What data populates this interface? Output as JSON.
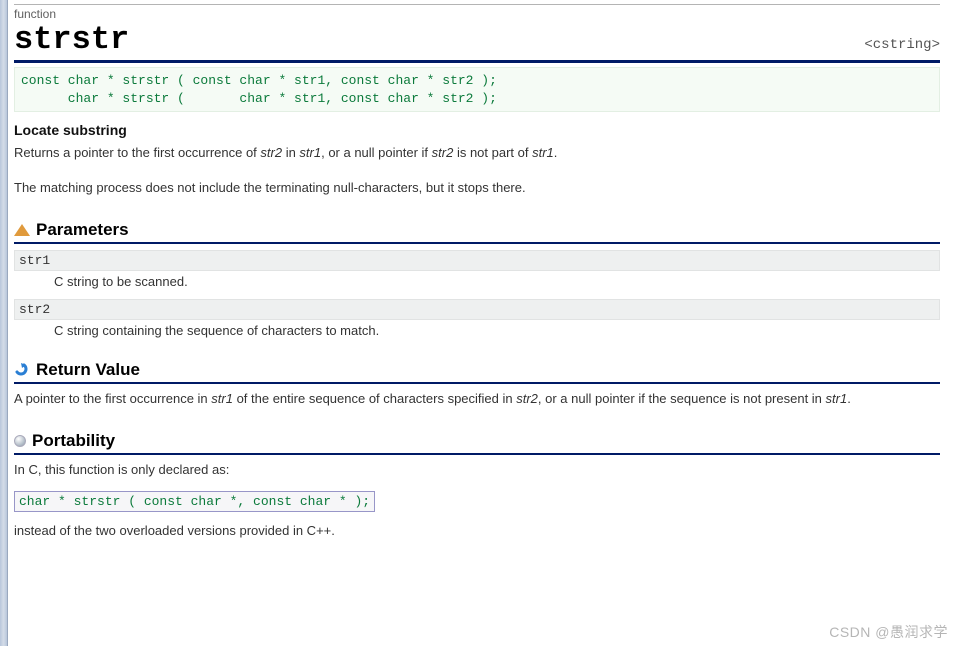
{
  "header": {
    "kind": "function",
    "title": "strstr",
    "include": "<cstring>"
  },
  "prototypes": "const char * strstr ( const char * str1, const char * str2 );\n      char * strstr (       char * str1, const char * str2 );",
  "subtitle": "Locate substring",
  "desc1_pre": "Returns a pointer to the first occurrence of ",
  "desc1_em1": "str2",
  "desc1_mid1": " in ",
  "desc1_em2": "str1",
  "desc1_mid2": ", or a null pointer if ",
  "desc1_em3": "str2",
  "desc1_mid3": " is not part of ",
  "desc1_em4": "str1",
  "desc1_end": ".",
  "desc2": "The matching process does not include the terminating null-characters, but it stops there.",
  "sections": {
    "params": {
      "title": "Parameters",
      "items": [
        {
          "name": "str1",
          "desc": "C string to be scanned."
        },
        {
          "name": "str2",
          "desc": "C string containing the sequence of characters to match."
        }
      ]
    },
    "return": {
      "title": "Return Value",
      "text_pre": "A pointer to the first occurrence in ",
      "text_em1": "str1",
      "text_mid": " of the entire sequence of characters specified in ",
      "text_em2": "str2",
      "text_mid2": ", or a null pointer if the sequence is not present in ",
      "text_em3": "str1",
      "text_end": "."
    },
    "portability": {
      "title": "Portability",
      "line1": "In C, this function is only declared as:",
      "code": "char * strstr ( const char *, const char * );",
      "line2": "instead of the two overloaded versions provided in C++."
    }
  },
  "watermark": "CSDN @愚润求学"
}
